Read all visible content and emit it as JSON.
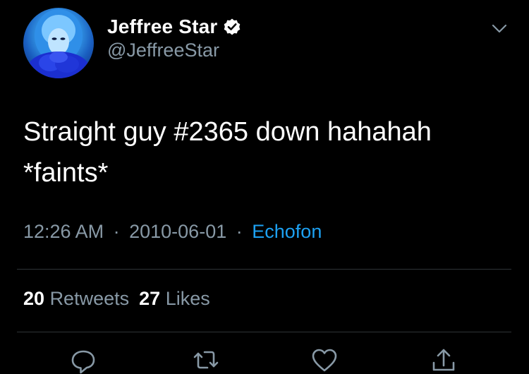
{
  "user": {
    "display_name": "Jeffree Star",
    "handle": "@JeffreeStar",
    "verified": true,
    "avatar_icon": "profile-avatar"
  },
  "tweet": {
    "text_line1": "Straight guy #2365 down hahahah",
    "text_line2": "*faints*",
    "time": "12:26 AM",
    "separator": "·",
    "date": "2010-06-01",
    "source": "Echofon"
  },
  "stats": {
    "retweets_count": "20",
    "retweets_label": "Retweets",
    "likes_count": "27",
    "likes_label": "Likes"
  },
  "actions": {
    "reply_icon": "reply-icon",
    "retweet_icon": "retweet-icon",
    "like_icon": "heart-icon",
    "share_icon": "share-icon"
  },
  "colors": {
    "background": "#000000",
    "secondary_text": "#8899a6",
    "link": "#1da1f2",
    "divider": "#2f3336"
  }
}
